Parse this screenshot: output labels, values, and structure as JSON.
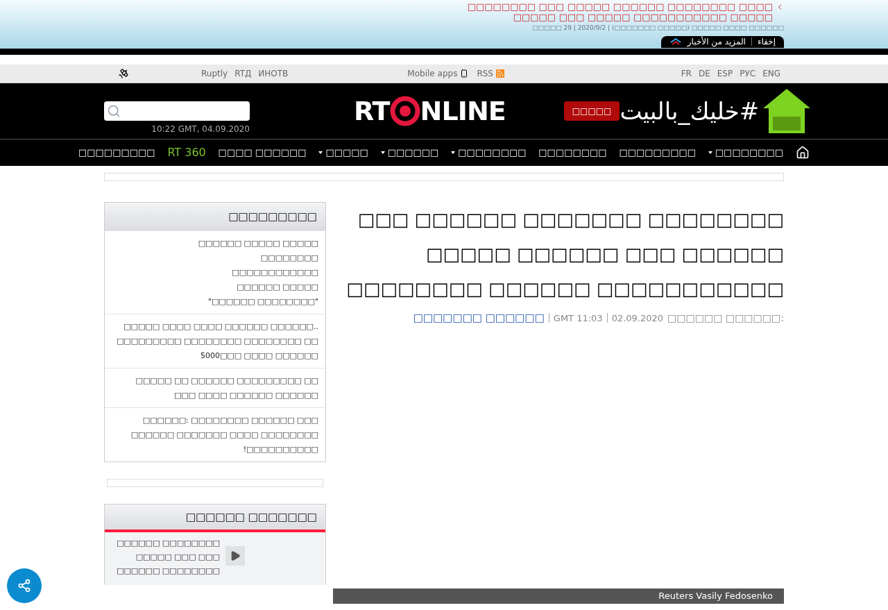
{
  "ticker": {
    "headline_lines": [
      "□□□□□□□□ □□□ □□□□□ □□□□□□ □□□□□□□□ □□□□",
      "□□□□□ □□□ □□□□□ □□□□□□□□□□□ □□□□□"
    ],
    "meta": "□□□□□ 29 | 2020/9/2 | (□□□□□□□ □□□□□) □□□□□ □□□□ □□□□□□",
    "more_label": "المزيد من الأخبار",
    "hide_label": "إخفاء"
  },
  "topbar": {
    "languages": [
      "FR",
      "DE",
      "ESP",
      "РУС",
      "ENG"
    ],
    "rss": "RSS",
    "mobile_apps": "Mobile apps",
    "partners": [
      "Ruptly",
      "RTД",
      "ИНОТВ"
    ]
  },
  "header": {
    "campaign": "#خليك_بالبيت",
    "live_button": "□□□□□",
    "logo_left": "RT",
    "logo_right": "NLINE",
    "clock": "10:22 GMT, 04.09.2020"
  },
  "nav": [
    {
      "label": "□□□□□□□□□",
      "has_menu": false,
      "kind": "text"
    },
    {
      "label": "RT 360",
      "has_menu": false,
      "kind": "accent"
    },
    {
      "label": "□□□□ □□□□□□",
      "has_menu": false,
      "kind": "text"
    },
    {
      "label": "□□□□□",
      "has_menu": true,
      "kind": "text"
    },
    {
      "label": "□□□□□□",
      "has_menu": true,
      "kind": "text"
    },
    {
      "label": "□□□□□□□□",
      "has_menu": true,
      "kind": "text"
    },
    {
      "label": "□□□□□□□□",
      "has_menu": false,
      "kind": "text"
    },
    {
      "label": "□□□□□□□□□",
      "has_menu": false,
      "kind": "text"
    },
    {
      "label": "□□□□□□□□",
      "has_menu": true,
      "kind": "text"
    }
  ],
  "sidebar": {
    "title": "□□□□□□□□□",
    "items": [
      "□□□□□ □□□□□ □□□□□□ □□□□□□□□ □□□□□□□□□□□□ □□□□□ □□□□□□ \"□□□□□□□□ □□□□□□\"",
      "..□□□□□□ □□□□□□ □□□□ □□□□ □□□□□ □□ □□□□□□□□ □□□□□□□□ □□□□□□□□□ □□□□□□ □□□□ □□□5000",
      "□□ □□□□□□□□□ □□□□□□ □□ □□□□□ □□□□□□ □□□□□□ □□□□ □□□",
      "□□□ □□□□□□ □□□□□□□□ :□□□□□□ □□□□□□□□ □□□□ □□□□□□□ □□□□□□ □□□□□□□□□□!"
    ]
  },
  "videos": {
    "title": "□□□□□□ □□□□□□□",
    "items": [
      "□□□□□□□□ □□□□□□ □□□ □□□ □□□□□ □□□□□□□□ □□□□□□"
    ]
  },
  "article": {
    "title": "□□□ □□□□□□ □□□□□□□ □□□□□□□□ □□□□□ □□□□□□ □□□ □□□□□□ □□□□□□□□ □□□□□□ □□□□□□□□□□□",
    "date": "02.09.2020",
    "time": "GMT 11:03",
    "date_label": "□□□□□□ □□□□□□:",
    "author": "□□□□□□□ □□□□□□",
    "photo_credit": "Reuters Vasily Fedosenko"
  }
}
